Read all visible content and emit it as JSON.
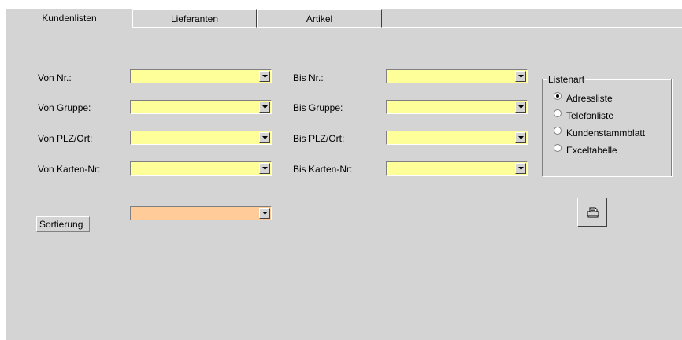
{
  "tabs": [
    {
      "label": "Kundenlisten",
      "active": true
    },
    {
      "label": "Lieferanten",
      "active": false
    },
    {
      "label": "Artikel",
      "active": false
    }
  ],
  "filters": {
    "von_nr": "Von Nr.:",
    "von_gruppe": "Von Gruppe:",
    "von_plz": "Von PLZ/Ort:",
    "von_karten": "Von Karten-Nr:",
    "bis_nr": "Bis Nr.:",
    "bis_gruppe": "Bis Gruppe:",
    "bis_plz": "Bis PLZ/Ort:",
    "bis_karten": "Bis Karten-Nr:"
  },
  "sort": {
    "label": "Sortierung",
    "value": ""
  },
  "listenart": {
    "title": "Listenart",
    "options": [
      "Adressliste",
      "Telefonliste",
      "Kundenstammblatt",
      "Exceltabelle"
    ],
    "selected": "Adressliste"
  },
  "colors": {
    "field": "#ffff99",
    "sort_field": "#ffcc99",
    "panel": "#d4d4d4"
  },
  "icons": {
    "print": "printer-icon",
    "dropdown": "chevron-down-icon"
  }
}
